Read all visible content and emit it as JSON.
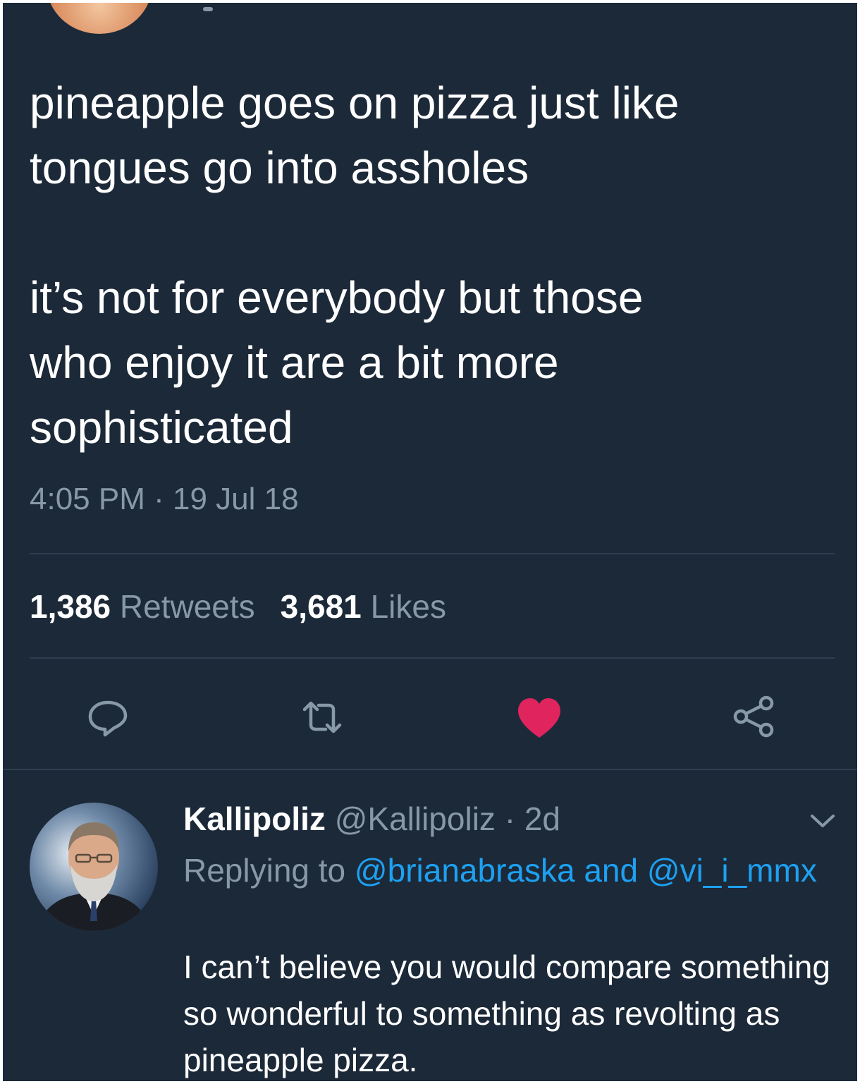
{
  "tweet": {
    "text": "pineapple goes on pizza just like\ntongues go into assholes\n\nit’s not for everybody but those\nwho enjoy it are a bit more\nsophisticated",
    "time": "4:05 PM",
    "date_separator": " · ",
    "date": "19 Jul 18",
    "retweets_count": "1,386",
    "retweets_label": "Retweets",
    "likes_count": "3,681",
    "likes_label": "Likes",
    "liked": true
  },
  "actions": {
    "reply_icon": "reply-bubble-icon",
    "retweet_icon": "retweet-arrows-icon",
    "like_icon": "heart-icon",
    "share_icon": "share-nodes-icon",
    "like_color": "#e0245e",
    "icon_color": "#8899a6"
  },
  "reply": {
    "name": "Kallipoliz",
    "handle": "@Kallipoliz",
    "separator": " · ",
    "age": "2d",
    "replying_prefix": "Replying to",
    "mention_1": "@brianabraska",
    "mention_joiner": "and",
    "mention_2": "@vi_i_mmx",
    "text": "I can’t believe you would compare something so wonderful to something as revolting as pineapple pizza."
  },
  "colors": {
    "background": "#1c2938",
    "text": "#ffffff",
    "secondary": "#8899a6",
    "link": "#1da1f2",
    "divider": "#2f3e4e"
  }
}
